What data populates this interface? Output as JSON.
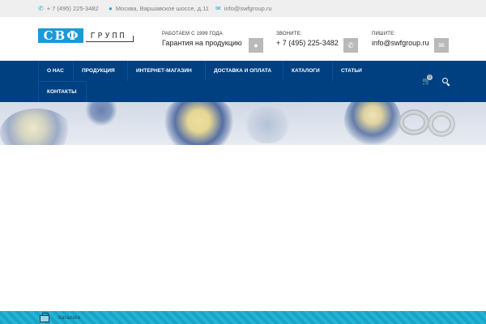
{
  "topbar": {
    "phone": "+ 7 (495) 225-3482",
    "phone_icon": "phone-icon",
    "address": "Москва, Варшавское шоссе, д.11",
    "address_icon": "map-marker-icon",
    "email": "info@swfgroup.ru",
    "email_icon": "envelope-icon"
  },
  "logo": {
    "letters": [
      "С",
      "В",
      "Ф"
    ],
    "suffix": "ГРУПП"
  },
  "header": {
    "blocks": [
      {
        "label": "РАБОТАЕМ С 1999 ГОДА",
        "value": "Гарантия на продукцию",
        "icon": "globe-icon"
      },
      {
        "label": "ЗВОНИТЕ:",
        "value": "+ 7 (495) 225-3482",
        "icon": "phone-icon"
      },
      {
        "label": "ПИШИТЕ:",
        "value": "info@swfgroup.ru",
        "icon": "envelope-icon"
      }
    ]
  },
  "nav": {
    "items": [
      "О НАС",
      "ПРОДУКЦИЯ",
      "ИНТЕРНЕТ-МАГАЗИН",
      "ДОСТАВКА И ОПЛАТА",
      "КАТАЛОГИ",
      "СТАТЬИ",
      "КОНТАКТЫ"
    ],
    "cart_count": "0",
    "cart_icon": "cart-icon",
    "search_icon": "search-icon"
  },
  "footer": {
    "label": "Каталоги",
    "icon": "catalog-icon"
  },
  "colors": {
    "topbar_bg": "#efefef",
    "accent_icon": "#2aa7d8",
    "nav_bg": "#003f80",
    "logo_blue": "#1b9ad6",
    "header_icon_bg": "#b9b9b9",
    "footer_bg": "#19a3c5"
  }
}
